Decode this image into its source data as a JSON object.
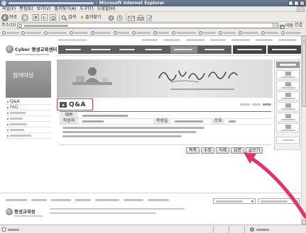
{
  "window": {
    "title": "- Microsoft Internet Explorer"
  },
  "menu": [
    "파일(F)",
    "편집(E)",
    "보기(V)",
    "즐겨찾기(A)",
    "도구(T)",
    "도움말(H)"
  ],
  "toolbar": {
    "back": "뒤로",
    "search": "검색",
    "favorites": "즐겨찾기"
  },
  "address": {
    "label": "주소(D)",
    "go": "이동",
    "links": "연결"
  },
  "site": {
    "logo": "Cyber 평생교육센터",
    "section": "참여마당",
    "sidebar": [
      "Q&A",
      "FAQ"
    ],
    "page_title": "Q&A"
  },
  "post": {
    "fields": {
      "title": "제목",
      "author": "작성자",
      "date": "작성일",
      "views": "조회"
    }
  },
  "buttons": [
    "목록",
    "수정",
    "삭제",
    "답변",
    "글쓰기"
  ],
  "footer": {
    "logo": "평생교육원"
  },
  "colors": {
    "annotation": "#e3336c",
    "nav": "#5e5e5e",
    "section_block": "#8a8a8a"
  },
  "icons": [
    "ie-icon",
    "back-arrow-icon",
    "forward-arrow-icon",
    "stop-icon",
    "refresh-icon",
    "home-icon",
    "search-icon",
    "star-icon",
    "media-icon",
    "history-icon",
    "mail-icon",
    "print-icon",
    "edit-icon",
    "windows-logo-icon",
    "go-arrow-icon",
    "globe-icon"
  ]
}
